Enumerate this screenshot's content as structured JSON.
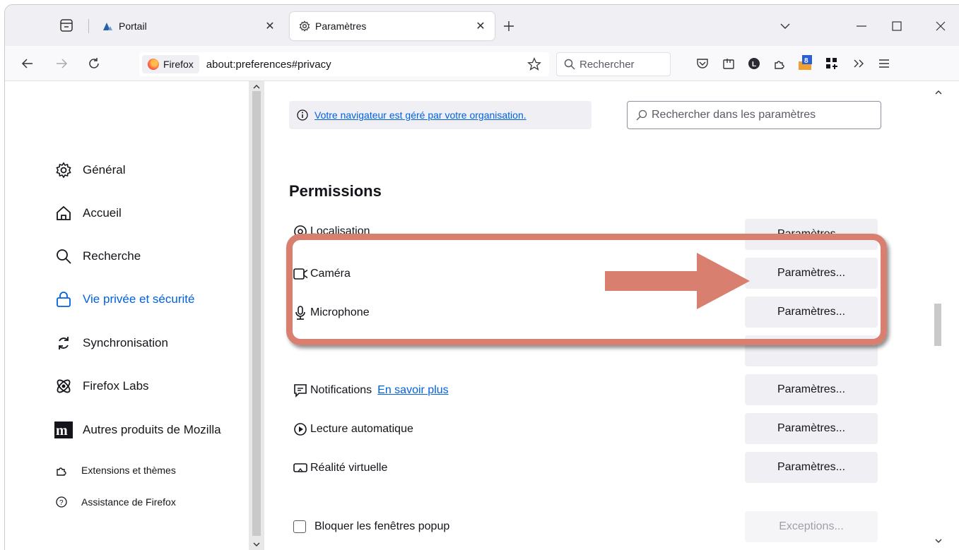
{
  "tabs": [
    {
      "title": "Portail",
      "icon": "portal-icon"
    },
    {
      "title": "Paramètres",
      "icon": "gear-icon"
    }
  ],
  "navbar": {
    "identity_label": "Firefox",
    "url": "about:preferences#privacy",
    "search_placeholder": "Rechercher",
    "badge_count": "8"
  },
  "sidebar": {
    "items": [
      {
        "label": "Général",
        "icon": "gear-icon"
      },
      {
        "label": "Accueil",
        "icon": "home-icon"
      },
      {
        "label": "Recherche",
        "icon": "search-icon"
      },
      {
        "label": "Vie privée et sécurité",
        "icon": "lock-icon",
        "selected": true
      },
      {
        "label": "Synchronisation",
        "icon": "sync-icon"
      },
      {
        "label": "Firefox Labs",
        "icon": "labs-icon"
      },
      {
        "label": "Autres produits de Mozilla",
        "icon": "mozilla-icon"
      }
    ],
    "footer": [
      {
        "label": "Extensions et thèmes",
        "icon": "puzzle-icon"
      },
      {
        "label": "Assistance de Firefox",
        "icon": "help-icon"
      }
    ]
  },
  "main": {
    "managed_notice": "Votre navigateur est géré par votre organisation.",
    "search_placeholder": "Rechercher dans les paramètres",
    "section_title": "Permissions",
    "permissions": [
      {
        "label": "Localisation",
        "button": "Paramètres..."
      },
      {
        "label": "Caméra",
        "button": "Paramètres..."
      },
      {
        "label": "Microphone",
        "button": "Paramètres..."
      },
      {
        "label": "Notifications",
        "link": "En savoir plus",
        "button": "Paramètres..."
      },
      {
        "label": "Lecture automatique",
        "button": "Paramètres..."
      },
      {
        "label": "Réalité virtuelle",
        "button": "Paramètres..."
      }
    ],
    "popup_label": "Bloquer les fenêtres popup",
    "popup_button": "Exceptions..."
  },
  "colors": {
    "accent": "#0061e0",
    "annotation": "#d87f6f"
  }
}
